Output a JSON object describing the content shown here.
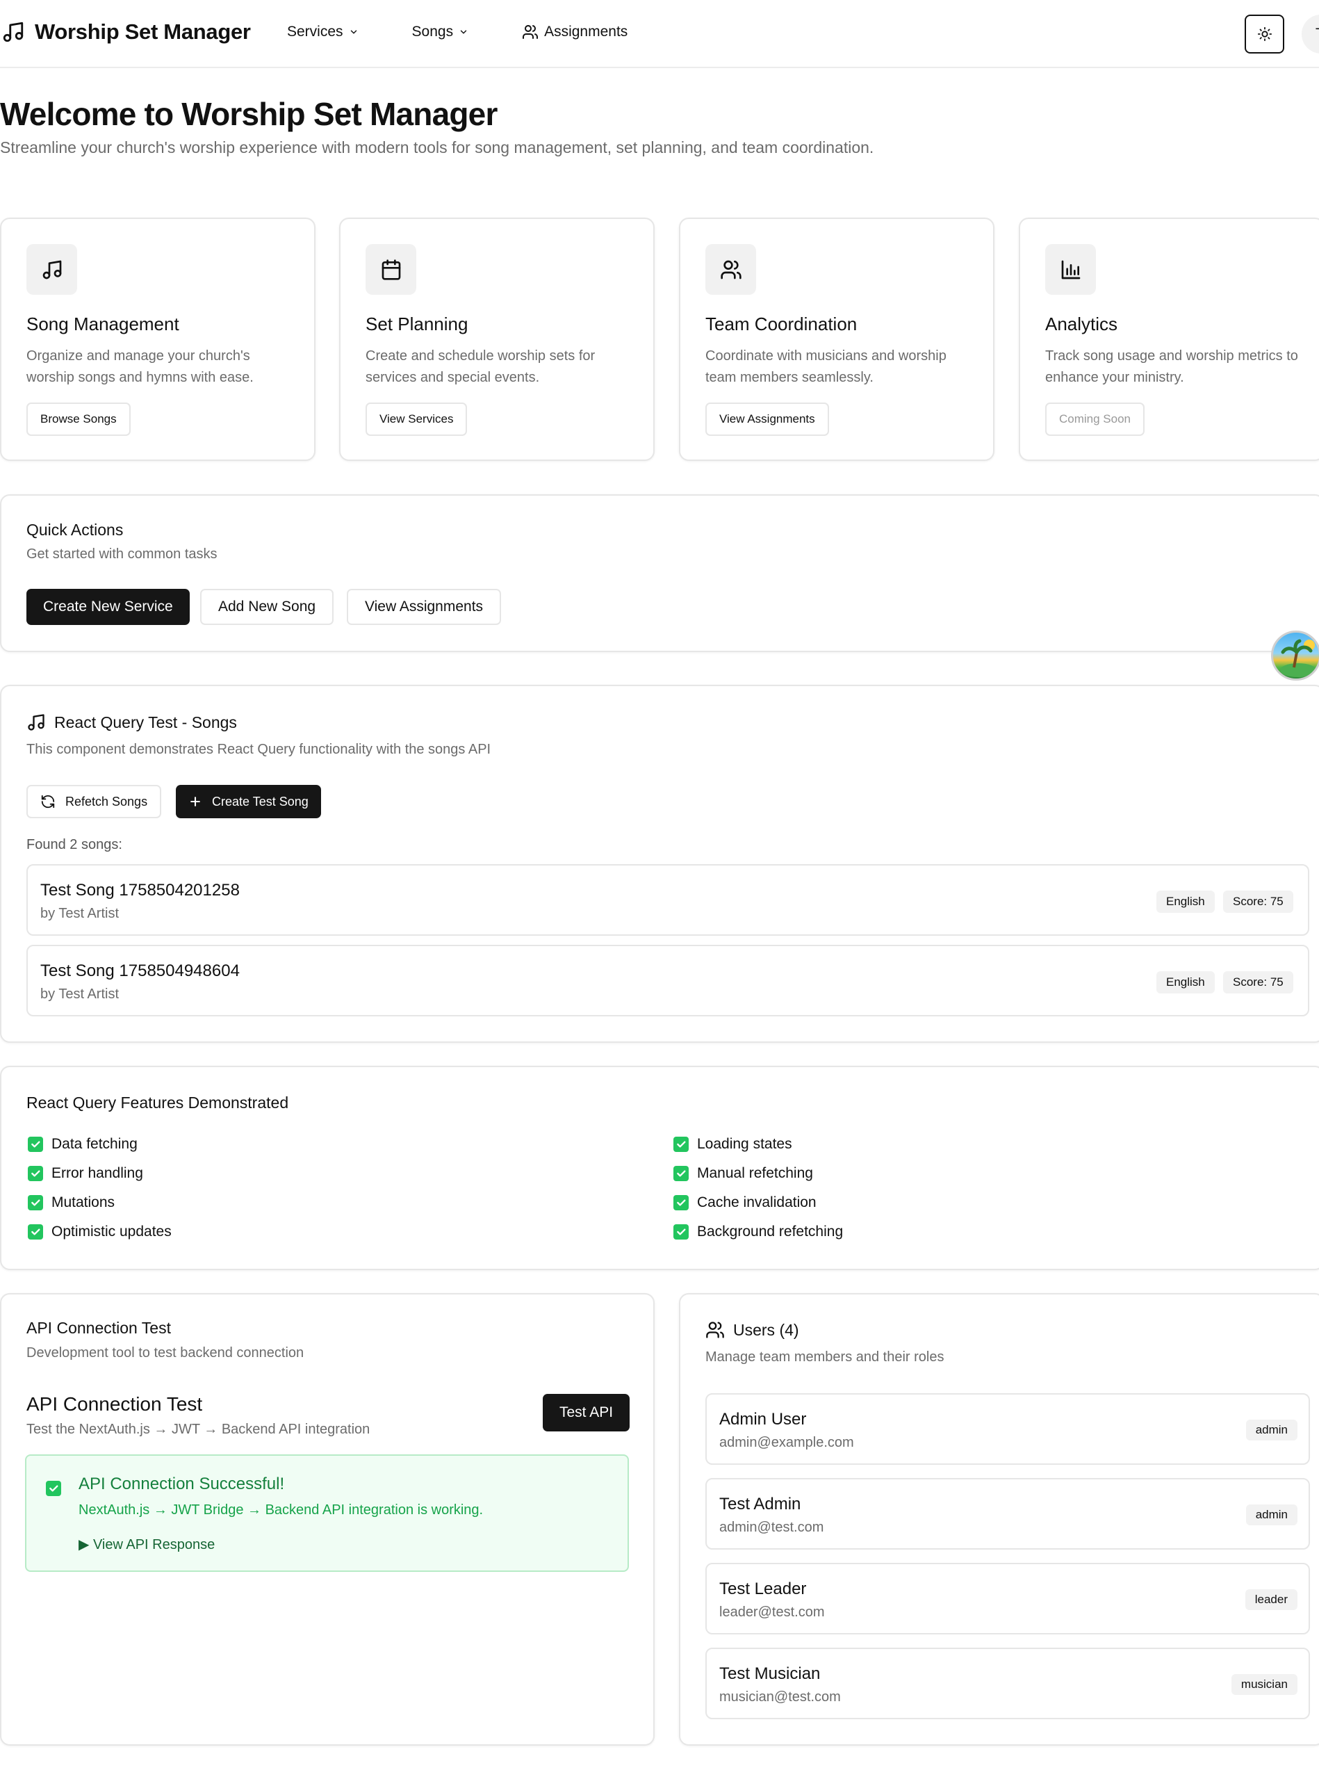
{
  "header": {
    "brand_icon": "music-note-icon",
    "brand_title": "Worship Set Manager",
    "nav": [
      {
        "label": "Services",
        "icon": "chevron-down-icon"
      },
      {
        "label": "Songs",
        "icon": "chevron-down-icon"
      },
      {
        "label": "Assignments",
        "icon": "users-icon"
      }
    ],
    "theme_icon": "sun-icon",
    "avatar_initial": "T"
  },
  "hero": {
    "title": "Welcome to Worship Set Manager",
    "subtitle": "Streamline your church's worship experience with modern tools for song management, set planning, and team coordination."
  },
  "features": [
    {
      "icon": "music-note-icon",
      "title": "Song Management",
      "description": "Organize and manage your church's worship songs and hymns with ease.",
      "button": "Browse Songs",
      "disabled": false
    },
    {
      "icon": "calendar-icon",
      "title": "Set Planning",
      "description": "Create and schedule worship sets for services and special events.",
      "button": "View Services",
      "disabled": false
    },
    {
      "icon": "users-icon",
      "title": "Team Coordination",
      "description": "Coordinate with musicians and worship team members seamlessly.",
      "button": "View Assignments",
      "disabled": false
    },
    {
      "icon": "bar-chart-icon",
      "title": "Analytics",
      "description": "Track song usage and worship metrics to enhance your ministry.",
      "button": "Coming Soon",
      "disabled": true
    }
  ],
  "quick_actions": {
    "title": "Quick Actions",
    "subtitle": "Get started with common tasks",
    "buttons": [
      "Create New Service",
      "Add New Song",
      "View Assignments"
    ]
  },
  "rq_songs": {
    "title": "React Query Test - Songs",
    "subtitle": "This component demonstrates React Query functionality with the songs API",
    "refetch_label": "Refetch Songs",
    "create_label": "Create Test Song",
    "found_label": "Found 2 songs:",
    "songs": [
      {
        "title": "Test Song 1758504201258",
        "artist": "by Test Artist",
        "language": "English",
        "score": "Score: 75"
      },
      {
        "title": "Test Song 1758504948604",
        "artist": "by Test Artist",
        "language": "English",
        "score": "Score: 75"
      }
    ]
  },
  "rq_features": {
    "title": "React Query Features Demonstrated",
    "left": [
      "Data fetching",
      "Error handling",
      "Mutations",
      "Optimistic updates"
    ],
    "right": [
      "Loading states",
      "Manual refetching",
      "Cache invalidation",
      "Background refetching"
    ]
  },
  "api_test": {
    "card_title": "API Connection Test",
    "card_subtitle": "Development tool to test backend connection",
    "inner_title": "API Connection Test",
    "inner_subtitle": "Test the NextAuth.js → JWT → Backend API integration",
    "button_label": "Test API",
    "success_title": "API Connection Successful!",
    "success_message": "NextAuth.js → JWT Bridge → Backend API integration is working.",
    "details_label": "▶ View API Response"
  },
  "users": {
    "title": "Users (4)",
    "subtitle": "Manage team members and their roles",
    "list": [
      {
        "name": "Admin User",
        "email": "admin@example.com",
        "role": "admin"
      },
      {
        "name": "Test Admin",
        "email": "admin@test.com",
        "role": "admin"
      },
      {
        "name": "Test Leader",
        "email": "leader@test.com",
        "role": "leader"
      },
      {
        "name": "Test Musician",
        "email": "musician@test.com",
        "role": "musician"
      }
    ]
  },
  "colors": {
    "primary": "#161616",
    "success": "#22c55e",
    "success_text": "#15803d",
    "muted_text": "#6b6b6b",
    "border": "#e6e6e6"
  }
}
